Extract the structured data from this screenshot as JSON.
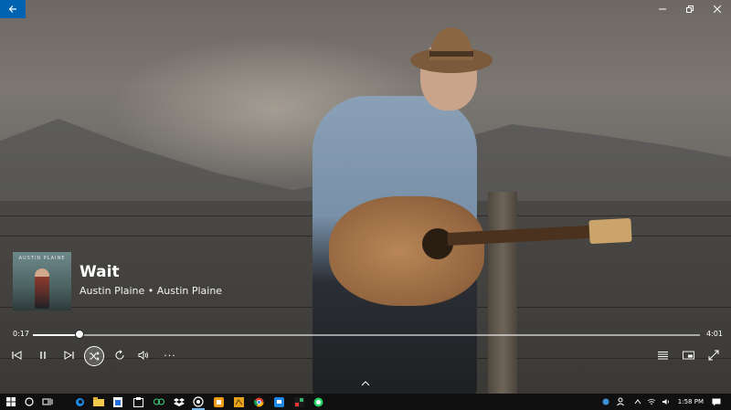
{
  "window": {
    "back_icon": "back-arrow-icon",
    "controls": [
      "minimize-icon",
      "restore-icon",
      "close-icon"
    ]
  },
  "now_playing": {
    "album_art_text": "AUSTIN PLAINE",
    "title": "Wait",
    "subtitle": "Austin Plaine • Austin Plaine"
  },
  "progress": {
    "elapsed": "0:17",
    "total": "4:01",
    "fraction": 0.0705
  },
  "controls": {
    "previous": "skip-previous-icon",
    "pause": "pause-icon",
    "next": "skip-next-icon",
    "shuffle": "shuffle-icon",
    "repeat": "repeat-icon",
    "volume": "volume-icon",
    "more": "···",
    "now_playing_list": "list-icon",
    "mini_view": "mini-view-icon",
    "full_screen": "full-screen-icon",
    "expand": "chevron-up-icon"
  },
  "taskbar": {
    "clock": "1:58 PM",
    "apps": [
      "start-icon",
      "cortana-icon",
      "task-view-icon",
      "edge-icon",
      "file-explorer-icon",
      "store-icon",
      "calendar-icon",
      "link-icon",
      "dropbox-icon",
      "groove-icon",
      "app-orange-icon",
      "app-amber-icon",
      "chrome-icon",
      "app-blue-icon",
      "app-red-icon",
      "whatsapp-icon"
    ]
  }
}
